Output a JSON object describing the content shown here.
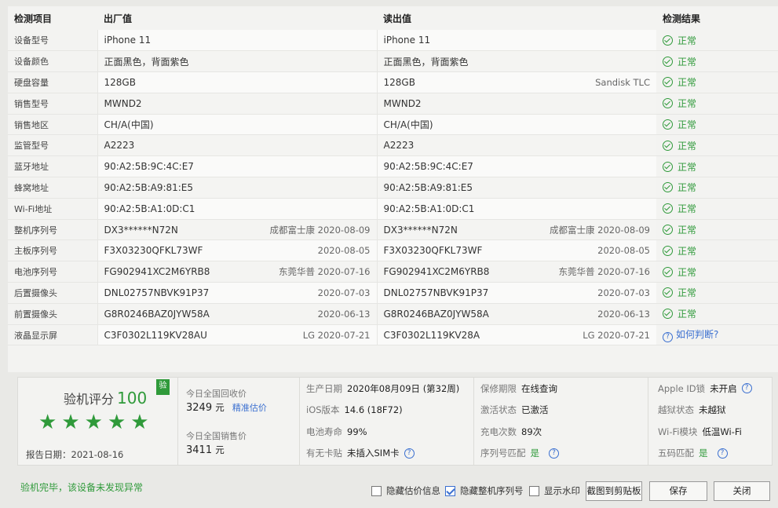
{
  "table": {
    "headers": [
      "检测项目",
      "出厂值",
      "读出值",
      "检测结果"
    ],
    "rows": [
      {
        "label": "设备型号",
        "factory": "iPhone 11",
        "factory_extra": "",
        "read": "iPhone 11",
        "read_extra": "",
        "result": "正常",
        "result_type": "ok"
      },
      {
        "label": "设备颜色",
        "factory": "正面黑色，背面紫色",
        "factory_extra": "",
        "read": "正面黑色，背面紫色",
        "read_extra": "",
        "result": "正常",
        "result_type": "ok"
      },
      {
        "label": "硬盘容量",
        "factory": "128GB",
        "factory_extra": "",
        "read": "128GB",
        "read_extra": "Sandisk TLC",
        "result": "正常",
        "result_type": "ok"
      },
      {
        "label": "销售型号",
        "factory": "MWND2",
        "factory_extra": "",
        "read": "MWND2",
        "read_extra": "",
        "result": "正常",
        "result_type": "ok"
      },
      {
        "label": "销售地区",
        "factory": "CH/A(中国)",
        "factory_extra": "",
        "read": "CH/A(中国)",
        "read_extra": "",
        "result": "正常",
        "result_type": "ok"
      },
      {
        "label": "监管型号",
        "factory": "A2223",
        "factory_extra": "",
        "read": "A2223",
        "read_extra": "",
        "result": "正常",
        "result_type": "ok"
      },
      {
        "label": "蓝牙地址",
        "factory": "90:A2:5B:9C:4C:E7",
        "factory_extra": "",
        "read": "90:A2:5B:9C:4C:E7",
        "read_extra": "",
        "result": "正常",
        "result_type": "ok"
      },
      {
        "label": "蜂窝地址",
        "factory": "90:A2:5B:A9:81:E5",
        "factory_extra": "",
        "read": "90:A2:5B:A9:81:E5",
        "read_extra": "",
        "result": "正常",
        "result_type": "ok"
      },
      {
        "label": "Wi-Fi地址",
        "factory": "90:A2:5B:A1:0D:C1",
        "factory_extra": "",
        "read": "90:A2:5B:A1:0D:C1",
        "read_extra": "",
        "result": "正常",
        "result_type": "ok"
      },
      {
        "label": "整机序列号",
        "factory": "DX3******N72N",
        "factory_extra": "成都富士康 2020-08-09",
        "read": "DX3******N72N",
        "read_extra": "成都富士康 2020-08-09",
        "result": "正常",
        "result_type": "ok"
      },
      {
        "label": "主板序列号",
        "factory": "F3X03230QFKL73WF",
        "factory_extra": "2020-08-05",
        "read": "F3X03230QFKL73WF",
        "read_extra": "2020-08-05",
        "result": "正常",
        "result_type": "ok"
      },
      {
        "label": "电池序列号",
        "factory": "FG902941XC2M6YRB8",
        "factory_extra": "东莞华普 2020-07-16",
        "read": "FG902941XC2M6YRB8",
        "read_extra": "东莞华普 2020-07-16",
        "result": "正常",
        "result_type": "ok"
      },
      {
        "label": "后置摄像头",
        "factory": "DNL02757NBVK91P37",
        "factory_extra": "2020-07-03",
        "read": "DNL02757NBVK91P37",
        "read_extra": "2020-07-03",
        "result": "正常",
        "result_type": "ok"
      },
      {
        "label": "前置摄像头",
        "factory": "G8R0246BAZ0JYW58A",
        "factory_extra": "2020-06-13",
        "read": "G8R0246BAZ0JYW58A",
        "read_extra": "2020-06-13",
        "result": "正常",
        "result_type": "ok"
      },
      {
        "label": "液晶显示屏",
        "factory": "C3F0302L119KV28AU",
        "factory_extra": "LG 2020-07-21",
        "read": "C3F0302L119KV28A",
        "read_extra": "LG 2020-07-21",
        "result": "如何判断?",
        "result_type": "question"
      }
    ]
  },
  "score": {
    "title": "验机评分",
    "value": "100",
    "badge": "验",
    "stars": 5,
    "report_date_label": "报告日期：",
    "report_date": "2021-08-16"
  },
  "prices": {
    "recycle_label": "今日全国回收价",
    "recycle_value": "3249",
    "recycle_unit": "元",
    "recycle_link": "精准估价",
    "sale_label": "今日全国销售价",
    "sale_value": "3411",
    "sale_unit": "元"
  },
  "info1": [
    {
      "k": "生产日期",
      "v": "2020年08月09日 (第32周)"
    },
    {
      "k": "iOS版本",
      "v": "14.6 (18F72)"
    },
    {
      "k": "电池寿命",
      "v": "99%"
    },
    {
      "k": "有无卡贴",
      "v": "未插入SIM卡"
    }
  ],
  "info2": [
    {
      "k": "保修期限",
      "v": "在线查询"
    },
    {
      "k": "激活状态",
      "v": "已激活"
    },
    {
      "k": "充电次数",
      "v": "89次"
    },
    {
      "k": "序列号匹配",
      "v": "是"
    }
  ],
  "info3": [
    {
      "k": "Apple ID锁",
      "v": "未开启"
    },
    {
      "k": "越狱状态",
      "v": "未越狱"
    },
    {
      "k": "Wi-Fi模块",
      "v": "低温Wi-Fi"
    },
    {
      "k": "五码匹配",
      "v": "是"
    }
  ],
  "bottom": {
    "message": "验机完毕，该设备未发现异常",
    "chk_hide_price": "隐藏估价信息",
    "chk_hide_serial": "隐藏整机序列号",
    "chk_watermark": "显示水印",
    "btn_screenshot": "截图到剪贴板",
    "btn_save": "保存",
    "btn_close": "关闭"
  },
  "colors": {
    "accent_green": "#2f9a3a",
    "link_blue": "#3a6fd0"
  }
}
